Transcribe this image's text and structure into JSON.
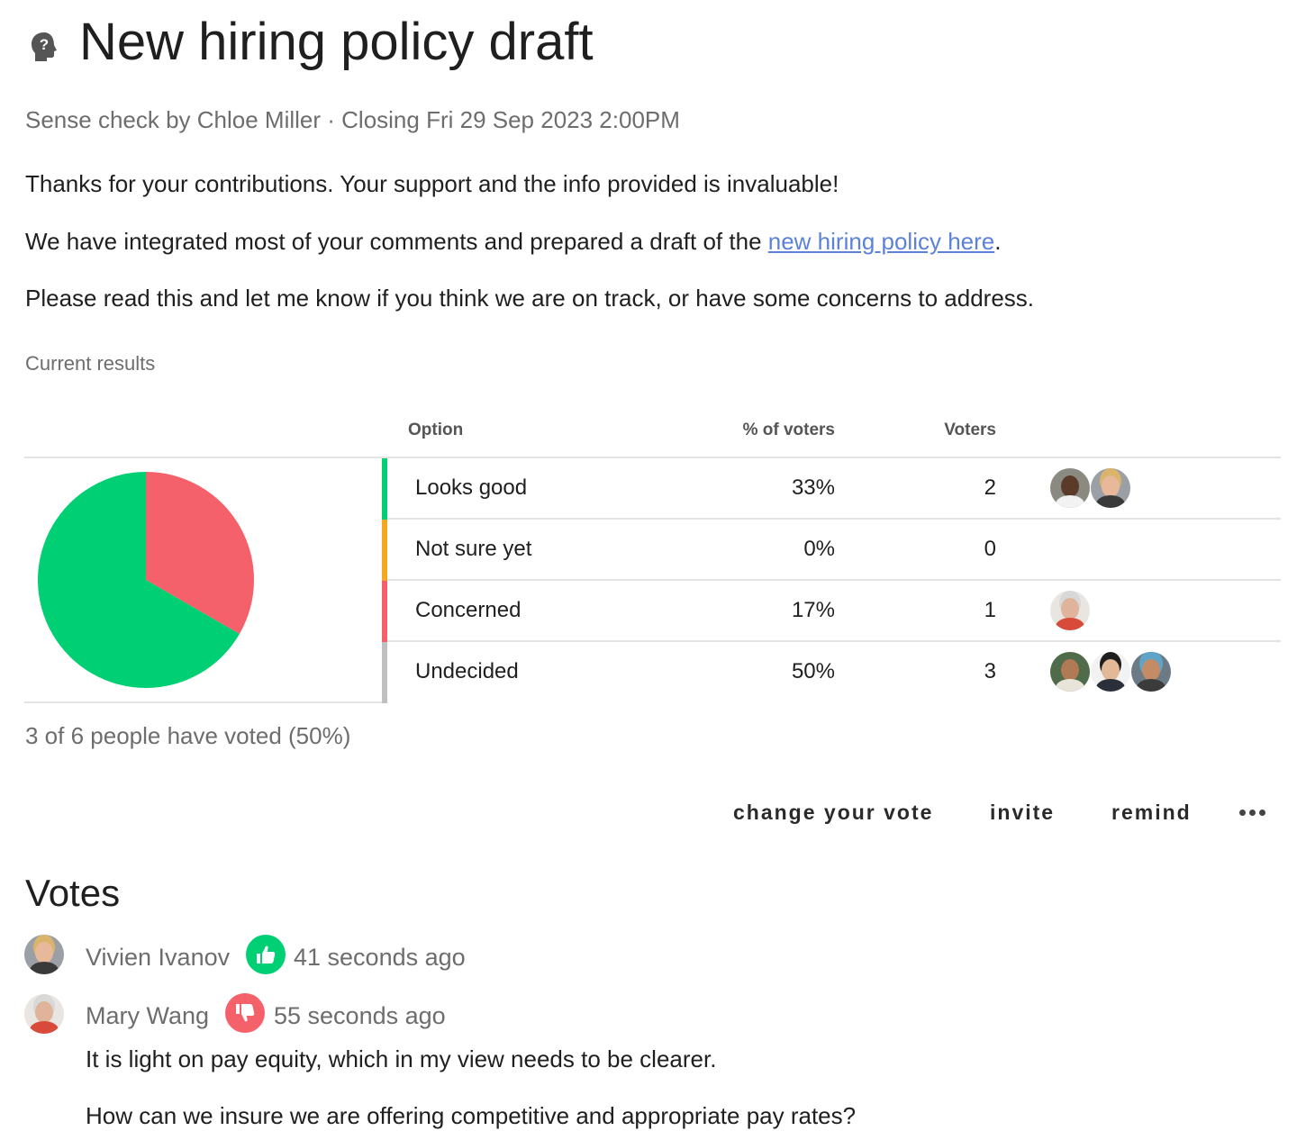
{
  "header": {
    "title": "New hiring policy draft",
    "icon": "question-head-icon",
    "subtitle": "Sense check by Chloe Miller · Closing Fri 29 Sep 2023 2:00PM"
  },
  "body": {
    "paragraph1": "Thanks for your contributions. Your support and the info provided is invaluable!",
    "paragraph2_before": "We have integrated most of your comments and prepared a draft of the ",
    "paragraph2_link": "new hiring policy here",
    "paragraph2_after": ".",
    "paragraph3": "Please read this and let me know if you think we are on track, or have some concerns to address."
  },
  "results": {
    "label": "Current results",
    "columns": {
      "option": "Option",
      "percent": "% of voters",
      "voters": "Voters"
    },
    "rows": [
      {
        "name": "Looks good",
        "percent": "33%",
        "count": "2",
        "color": "#00d073"
      },
      {
        "name": "Not sure yet",
        "percent": "0%",
        "count": "0",
        "color": "#f5a623"
      },
      {
        "name": "Concerned",
        "percent": "17%",
        "count": "1",
        "color": "#f5616a"
      },
      {
        "name": "Undecided",
        "percent": "50%",
        "count": "3",
        "color": "#c0c0c0"
      }
    ],
    "summary": "3 of 6 people have voted (50%)"
  },
  "chart_data": {
    "type": "pie",
    "categories": [
      "Looks good",
      "Concerned"
    ],
    "values": [
      2,
      1
    ],
    "colors": [
      "#00d073",
      "#f5616a"
    ]
  },
  "actions": {
    "change_vote": "change your vote",
    "invite": "invite",
    "remind": "remind",
    "more_icon": "more-dots-icon"
  },
  "votes": {
    "heading": "Votes",
    "items": [
      {
        "name": "Vivien Ivanov",
        "time": "41 seconds ago",
        "reaction": "thumbs-up-icon",
        "reaction_color": "#00d073"
      },
      {
        "name": "Mary Wang",
        "time": "55 seconds ago",
        "reaction": "thumbs-down-icon",
        "reaction_color": "#f5616a",
        "comment": [
          "It is light on pay equity, which in my view needs to be clearer.",
          "How can we insure we are offering competitive and appropriate pay rates?"
        ]
      }
    ]
  }
}
